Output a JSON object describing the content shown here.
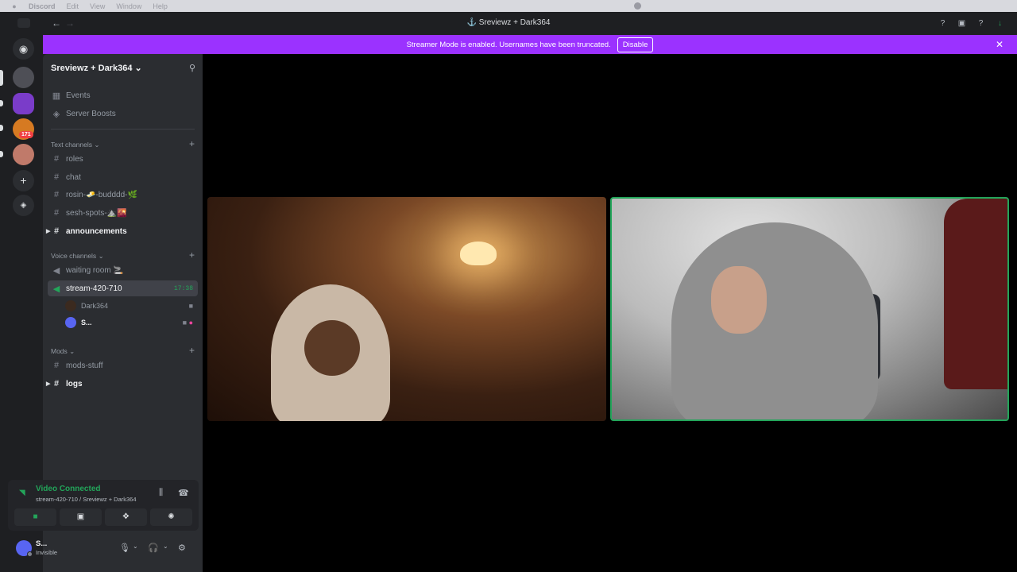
{
  "menubar": {
    "app": "Discord",
    "items": [
      "Edit",
      "View",
      "Window",
      "Help"
    ]
  },
  "titlebar": {
    "title": "Sreviewz + Dark364"
  },
  "banner": {
    "text": "Streamer Mode is enabled. Usernames have been truncated.",
    "button": "Disable"
  },
  "guilds": {
    "badge": "171"
  },
  "server": {
    "name": "Sreviewz + Dark364",
    "top_items": [
      {
        "icon": "calendar-icon",
        "label": "Events"
      },
      {
        "icon": "boost-icon",
        "label": "Server Boosts"
      }
    ],
    "categories": {
      "text": "Text channels",
      "voice": "Voice channels",
      "mods": "Mods"
    },
    "text_channels": [
      {
        "label": "roles"
      },
      {
        "label": "chat"
      },
      {
        "label": "rosin-🧈-budddd-🌿"
      },
      {
        "label": "sesh-spots-⛰️🌇"
      },
      {
        "label": "announcements"
      }
    ],
    "voice_channels": [
      {
        "label": "waiting room 🚬"
      },
      {
        "label": "stream-420-710",
        "time": "17:38"
      }
    ],
    "voice_users": [
      {
        "name": "Dark364"
      },
      {
        "name": "S..."
      }
    ],
    "mod_channels": [
      {
        "label": "mods-stuff"
      },
      {
        "label": "logs"
      }
    ]
  },
  "rtc": {
    "status": "Video Connected",
    "channel": "stream-420-710 / Sreviewz + Dark364"
  },
  "user_panel": {
    "name": "S...",
    "status": "Invisible"
  },
  "colors": {
    "banner": "#9b32ff",
    "connected": "#23a55a",
    "sidebar": "#2b2d31"
  }
}
